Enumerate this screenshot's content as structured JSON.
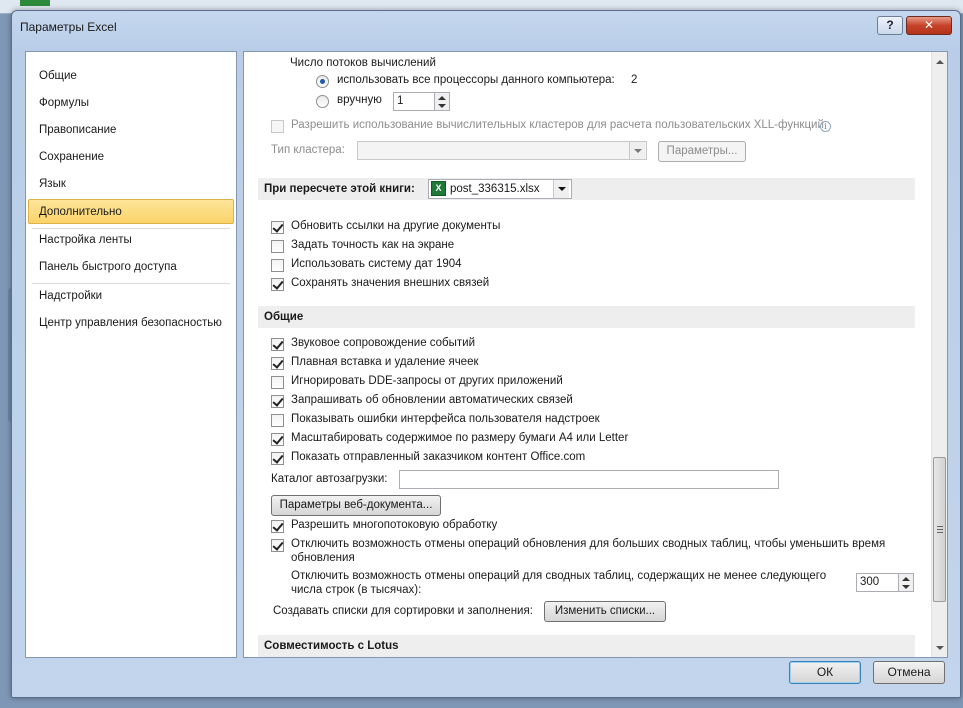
{
  "window": {
    "title": "Параметры Excel",
    "help_glyph": "?",
    "close_glyph": "✕"
  },
  "nav": {
    "items": [
      {
        "label": "Общие"
      },
      {
        "label": "Формулы"
      },
      {
        "label": "Правописание"
      },
      {
        "label": "Сохранение"
      },
      {
        "label": "Язык"
      },
      {
        "label": "Дополнительно",
        "selected": true
      },
      {
        "label": "Настройка ленты"
      },
      {
        "label": "Панель быстрого доступа"
      },
      {
        "label": "Надстройки"
      },
      {
        "label": "Центр управления безопасностью"
      }
    ]
  },
  "calc": {
    "threads_label": "Число потоков вычислений",
    "use_all_label": "использовать все процессоры данного компьютера:",
    "use_all_value": "2",
    "use_all_selected": true,
    "manual_label": "вручную",
    "manual_value": "1",
    "cluster_label": "Разрешить использование вычислительных кластеров для расчета пользовательских XLL-функций",
    "cluster_checked": false,
    "cluster_type_label": "Тип кластера:",
    "params_button": "Параметры..."
  },
  "recalc": {
    "header": "При пересчете этой книги:",
    "workbook": "post_336315.xlsx",
    "xl_icon_letter": "X",
    "options": [
      {
        "label": "Обновить ссылки на другие документы",
        "checked": true
      },
      {
        "label": "Задать точность как на экране",
        "checked": false
      },
      {
        "label": "Использовать систему дат 1904",
        "checked": false
      },
      {
        "label": "Сохранять значения внешних связей",
        "checked": true
      }
    ]
  },
  "general": {
    "header": "Общие",
    "options": [
      {
        "label": "Звуковое сопровождение событий",
        "checked": true
      },
      {
        "label": "Плавная вставка и удаление ячеек",
        "checked": true
      },
      {
        "label": "Игнорировать DDE-запросы от других приложений",
        "checked": false
      },
      {
        "label": "Запрашивать об обновлении автоматических связей",
        "checked": true
      },
      {
        "label": "Показывать ошибки интерфейса пользователя надстроек",
        "checked": false
      },
      {
        "label": "Масштабировать содержимое по размеру бумаги A4 или Letter",
        "checked": true
      },
      {
        "label": "Показать отправленный заказчиком контент Office.com",
        "checked": true
      }
    ],
    "startup_label": "Каталог автозагрузки:",
    "startup_value": "",
    "web_options_button": "Параметры веб-документа...",
    "multithread_label": "Разрешить многопотоковую обработку",
    "multithread_checked": true,
    "disable_undo_label_1": "Отключить возможность отмены операций обновления для больших сводных таблиц, чтобы уменьшить время",
    "disable_undo_label_2": "обновления",
    "disable_undo_checked": true,
    "rows_label_1": "Отключить возможность отмены операций для сводных таблиц, содержащих не менее следующего",
    "rows_label_2": "числа строк (в тысячах):",
    "rows_value": "300",
    "lists_label": "Создавать списки для сортировки и заполнения:",
    "edit_lists_button": "Изменить списки..."
  },
  "lotus": {
    "header": "Совместимость с Lotus"
  },
  "footer": {
    "ok": "ОК",
    "cancel": "Отмена"
  }
}
